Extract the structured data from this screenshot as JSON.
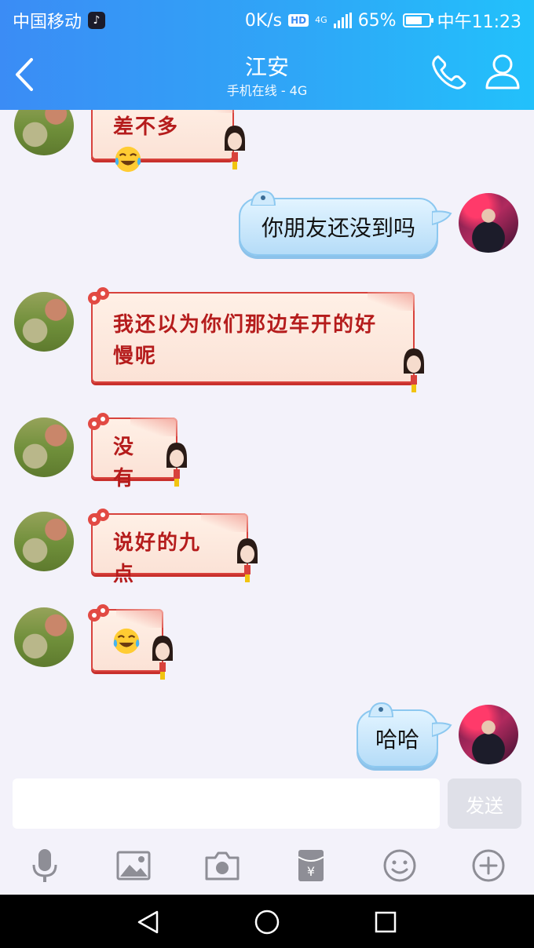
{
  "status": {
    "carrier": "中国移动",
    "speed": "0K/s",
    "hd": "HD",
    "net": "4G",
    "battery": "65%",
    "time": "中午11:23"
  },
  "header": {
    "title": "江安",
    "subtitle": "手机在线 - 4G"
  },
  "messages": [
    {
      "from": "friend",
      "text": "差不多"
    },
    {
      "from": "me",
      "text": "你朋友还没到吗"
    },
    {
      "from": "friend",
      "text": "我还以为你们那边车开的好慢呢"
    },
    {
      "from": "friend",
      "text": "没有"
    },
    {
      "from": "friend",
      "text": "说好的九点"
    },
    {
      "from": "friend",
      "text": ""
    },
    {
      "from": "me",
      "text": "哈哈"
    }
  ],
  "composer": {
    "placeholder": "",
    "send_label": "发送"
  },
  "icons": {
    "toolbar": [
      "microphone-icon",
      "image-icon",
      "camera-icon",
      "red-packet-icon",
      "emoji-icon",
      "plus-icon"
    ],
    "nav": [
      "back-triangle-icon",
      "home-circle-icon",
      "recents-square-icon"
    ]
  },
  "colors": {
    "header_start": "#3b8cf5",
    "header_end": "#22c1fb",
    "bubble_red": "#d8423c",
    "bubble_blue": "#b5dcf8"
  }
}
